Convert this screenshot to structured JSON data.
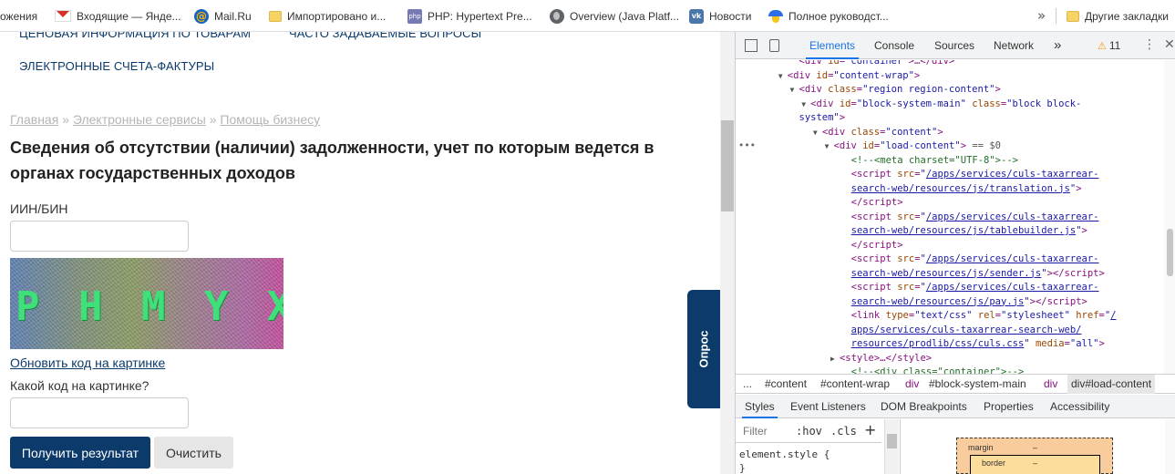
{
  "bookmarks": {
    "items": [
      {
        "label": "ожения",
        "icon": "none"
      },
      {
        "label": "Входящие — Янде...",
        "icon": "gmail-icon"
      },
      {
        "label": "Mail.Ru",
        "icon": "mailru-icon"
      },
      {
        "label": "Импортировано и...",
        "icon": "folder-icon"
      },
      {
        "label": "PHP: Hypertext Pre...",
        "icon": "php-icon"
      },
      {
        "label": "Overview (Java Platf...",
        "icon": "globe-icon"
      },
      {
        "label": "Новости",
        "icon": "vk-icon"
      },
      {
        "label": "Полное руководст...",
        "icon": "ukraine-icon"
      }
    ],
    "more": "»",
    "other": "Другие закладки",
    "icon_text": {
      "mailru": "@",
      "php": "php",
      "vk": "vk"
    }
  },
  "page": {
    "nav": {
      "price_info": "ЦЕНОВАЯ ИНФОРМАЦИЯ ПО ТОВАРАМ",
      "faq": "ЧАСТО ЗАДАВАЕМЫЕ ВОПРОСЫ",
      "invoices": "ЭЛЕКТРОННЫЕ СЧЕТА-ФАКТУРЫ"
    },
    "breadcrumb": [
      {
        "label": "Главная"
      },
      {
        "label": "Электронные сервисы"
      },
      {
        "label": "Помощь бизнесу"
      }
    ],
    "breadcrumb_sep": "»",
    "title": "Сведения об отсутствии (наличии) задолженности, учет по которым ведется в органах государственных доходов",
    "iin_label": "ИИН/БИН",
    "iin_value": "",
    "captcha_text": "P H M Y X",
    "refresh_link": "Обновить код на картинке",
    "captcha_question": "Какой код на картинке?",
    "captcha_value": "",
    "submit": "Получить результат",
    "clear": "Очистить",
    "feedback": "Опрос",
    "colors": {
      "brand": "#0b3a6b",
      "captcha_text": "#3fe07a"
    }
  },
  "devtools": {
    "tabs": [
      "Elements",
      "Console",
      "Sources",
      "Network"
    ],
    "active_tab": "Elements",
    "more_tabs": "»",
    "warnings": "11",
    "warning_glyph": "⚠",
    "kebab": "⋮",
    "close": "✕",
    "dom_lines": [
      {
        "indent": 10,
        "arrow": "",
        "html": "<span class=\"tg\">&lt;div</span> <span class=\"an\">id</span>=<span class=\"av\">\"container\"</span><span class=\"tg\">&gt;</span>…<span class=\"tg\">&lt;/div&gt;</span>"
      },
      {
        "indent": 8,
        "arrow": "▼",
        "html": "<span class=\"tg\">&lt;div</span> <span class=\"an\">id</span>=<span class=\"av\">\"content-wrap\"</span><span class=\"tg\">&gt;</span>"
      },
      {
        "indent": 10,
        "arrow": "▼",
        "html": "<span class=\"tg\">&lt;div</span> <span class=\"an\">class</span>=<span class=\"av\">\"region region-content\"</span><span class=\"tg\">&gt;</span>"
      },
      {
        "indent": 12,
        "arrow": "▼",
        "html": "<span class=\"tg\">&lt;div</span> <span class=\"an\">id</span>=<span class=\"av\">\"block-system-main\"</span> <span class=\"an\">class</span>=<span class=\"av\">\"block block-</span>"
      },
      {
        "indent": 10,
        "arrow": "",
        "html": "<span class=\"av\">system\"</span><span class=\"tg\">&gt;</span>"
      },
      {
        "indent": 14,
        "arrow": "▼",
        "html": "<span class=\"tg\">&lt;div</span> <span class=\"an\">class</span>=<span class=\"av\">\"content\"</span><span class=\"tg\">&gt;</span>"
      },
      {
        "indent": 16,
        "arrow": "▼",
        "sel": true,
        "html": "<span class=\"tg\">&lt;div</span> <span class=\"an\">id</span>=<span class=\"av\">\"load-content\"</span><span class=\"tg\">&gt;</span> <span class=\"eq\">== $0</span>"
      },
      {
        "indent": 19,
        "arrow": "",
        "html": "<span class=\"cm\">&lt;!--&lt;meta charset=\"UTF-8\"&gt;--&gt;</span>"
      },
      {
        "indent": 19,
        "arrow": "",
        "hl": true,
        "html": "<span class=\"tg\">&lt;script</span> <span class=\"an\">src</span>=<span class=\"av\">\"</span><span class=\"au\">/apps/services/culs-taxarrear-</span>"
      },
      {
        "indent": 19,
        "arrow": "",
        "hl": true,
        "html": "<span class=\"au\">search-web/resources/js/translation.js</span><span class=\"av\">\"</span><span class=\"tg\">&gt;</span>"
      },
      {
        "indent": 19,
        "arrow": "",
        "html": "<span class=\"tg\">&lt;/script&gt;</span>"
      },
      {
        "indent": 19,
        "arrow": "",
        "html": "<span class=\"tg\">&lt;script</span> <span class=\"an\">src</span>=<span class=\"av\">\"</span><span class=\"au\">/apps/services/culs-taxarrear-</span>"
      },
      {
        "indent": 19,
        "arrow": "",
        "html": "<span class=\"au\">search-web/resources/js/tablebuilder.js</span><span class=\"av\">\"</span><span class=\"tg\">&gt;</span>"
      },
      {
        "indent": 19,
        "arrow": "",
        "html": "<span class=\"tg\">&lt;/script&gt;</span>"
      },
      {
        "indent": 19,
        "arrow": "",
        "html": "<span class=\"tg\">&lt;script</span> <span class=\"an\">src</span>=<span class=\"av\">\"</span><span class=\"au\">/apps/services/culs-taxarrear-</span>"
      },
      {
        "indent": 19,
        "arrow": "",
        "html": "<span class=\"au\">search-web/resources/js/sender.js</span><span class=\"av\">\"</span><span class=\"tg\">&gt;&lt;/script&gt;</span>"
      },
      {
        "indent": 19,
        "arrow": "",
        "html": "<span class=\"tg\">&lt;script</span> <span class=\"an\">src</span>=<span class=\"av\">\"</span><span class=\"au\">/apps/services/culs-taxarrear-</span>"
      },
      {
        "indent": 19,
        "arrow": "",
        "html": "<span class=\"au\">search-web/resources/js/pay.js</span><span class=\"av\">\"</span><span class=\"tg\">&gt;&lt;/script&gt;</span>"
      },
      {
        "indent": 19,
        "arrow": "",
        "html": "<span class=\"tg\">&lt;link</span> <span class=\"an\">type</span>=<span class=\"av\">\"text/css\"</span> <span class=\"an\">rel</span>=<span class=\"av\">\"stylesheet\"</span> <span class=\"an\">href</span>=<span class=\"av\">\"</span><span class=\"au\">/</span>"
      },
      {
        "indent": 19,
        "arrow": "",
        "html": "<span class=\"au\">apps/services/culs-taxarrear-search-web/</span>"
      },
      {
        "indent": 19,
        "arrow": "",
        "html": "<span class=\"au\">resources/prodlib/css/culs.css</span><span class=\"av\">\"</span> <span class=\"an\">media</span>=<span class=\"av\">\"all\"</span><span class=\"tg\">&gt;</span>"
      },
      {
        "indent": 17,
        "arrow": "▶",
        "html": "<span class=\"tg\">&lt;style&gt;</span>…<span class=\"tg\">&lt;/style&gt;</span>"
      },
      {
        "indent": 19,
        "arrow": "",
        "html": "<span class=\"cm\">&lt;!--&lt;div class=\"container\"&gt;--&gt;</span>"
      }
    ],
    "selected_dots": "•••",
    "breadcrumbs": [
      {
        "label": "...",
        "tag": false
      },
      {
        "label": "#content",
        "tag": false
      },
      {
        "label": "#content-wrap",
        "tag": false
      },
      {
        "label": "div",
        "tag": true
      },
      {
        "label": "#block-system-main",
        "tag": false
      },
      {
        "label": "div",
        "tag": true
      },
      {
        "label": "div#load-content",
        "tag": false,
        "sel": true
      }
    ],
    "sub_tabs": [
      "Styles",
      "Event Listeners",
      "DOM Breakpoints",
      "Properties",
      "Accessibility"
    ],
    "active_sub_tab": "Styles",
    "filter_placeholder": "Filter",
    "hov": ":hov",
    "cls": ".cls",
    "plus": "+",
    "element_style_open": "element.style {",
    "element_style_close": "}",
    "box_margin_label": "margin",
    "box_margin_value": "–",
    "box_border_label": "border",
    "box_border_value": "–"
  }
}
